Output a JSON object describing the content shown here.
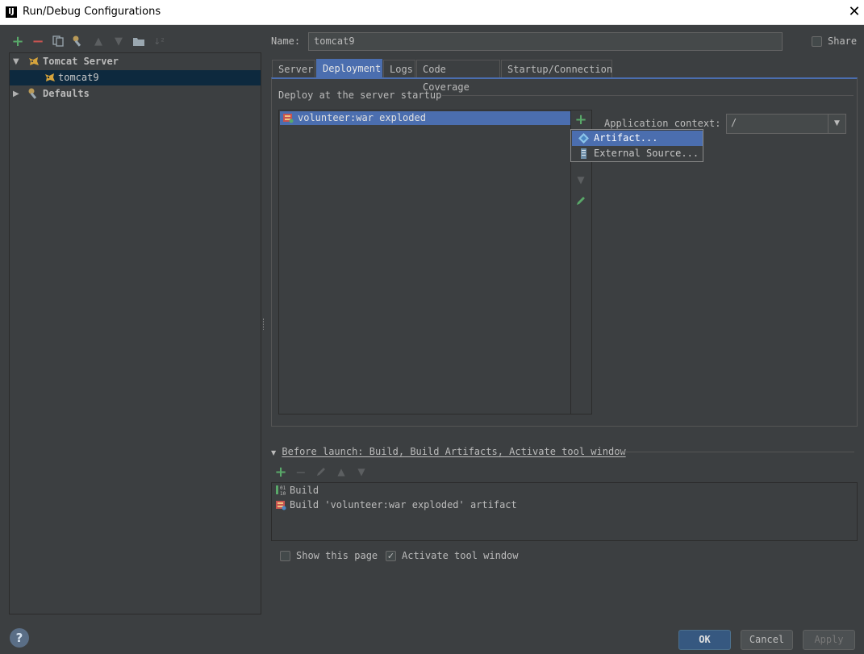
{
  "window": {
    "title": "Run/Debug Configurations",
    "app_icon_text": "IJ"
  },
  "left_toolbar": {
    "icons": [
      "add-icon",
      "remove-icon",
      "copy-icon",
      "edit-defaults-icon",
      "move-up-icon",
      "move-down-icon",
      "folder-icon",
      "sort-icon"
    ]
  },
  "tree": {
    "items": [
      {
        "label": "Tomcat Server",
        "expanded": true,
        "bold": true
      },
      {
        "label": "tomcat9",
        "selected": true
      },
      {
        "label": "Defaults",
        "expanded": false,
        "bold": true
      }
    ]
  },
  "name_field": {
    "label": "Name:",
    "value": "tomcat9"
  },
  "share": {
    "label": "Share",
    "checked": false
  },
  "tabs": [
    {
      "label": "Server"
    },
    {
      "label": "Deployment",
      "active": true
    },
    {
      "label": "Logs"
    },
    {
      "label": "Code Coverage"
    },
    {
      "label": "Startup/Connection"
    }
  ],
  "deployment": {
    "section_title": "Deploy at the server startup",
    "items": [
      "volunteer:war exploded"
    ],
    "app_context_label": "Application context:",
    "app_context_value": "/"
  },
  "popup_menu": {
    "items": [
      {
        "label": "Artifact...",
        "selected": true
      },
      {
        "label": "External Source..."
      }
    ]
  },
  "before_launch": {
    "title": "Before launch: Build, Build Artifacts, Activate tool window",
    "items": [
      "Build",
      "Build 'volunteer:war exploded' artifact"
    ]
  },
  "options": {
    "show_page": {
      "label": "Show this page",
      "checked": false
    },
    "activate_tool": {
      "label": "Activate tool window",
      "checked": true
    }
  },
  "buttons": {
    "ok": "OK",
    "cancel": "Cancel",
    "apply": "Apply",
    "help": "?"
  },
  "colors": {
    "background": "#3c3f41",
    "selection": "#4b6eaf",
    "tree_selection": "#0d293e",
    "add_green": "#59a869"
  }
}
